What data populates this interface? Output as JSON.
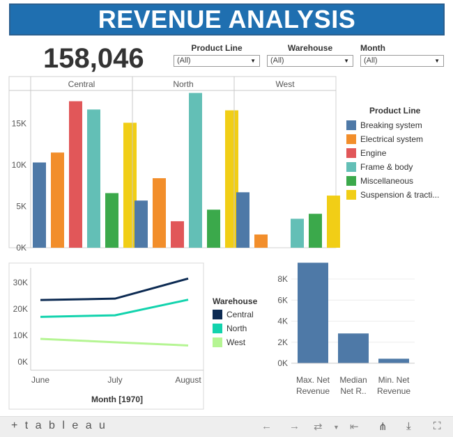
{
  "title": "REVENUE ANALYSIS",
  "kpi": "158,046",
  "filters": [
    {
      "label": "Product Line",
      "value": "(All)"
    },
    {
      "label": "Warehouse",
      "value": "(All)"
    },
    {
      "label": "Month",
      "value": "(All)"
    }
  ],
  "legend_product": {
    "title": "Product Line",
    "items": [
      {
        "label": "Breaking system",
        "color": "#4e79a7"
      },
      {
        "label": "Electrical system",
        "color": "#f28e2b"
      },
      {
        "label": "Engine",
        "color": "#e15759"
      },
      {
        "label": "Frame & body",
        "color": "#63bfb6"
      },
      {
        "label": "Miscellaneous",
        "color": "#3ba94b"
      },
      {
        "label": "Suspension & tracti...",
        "color": "#f1ce16"
      }
    ]
  },
  "legend_warehouse": {
    "title": "Warehouse",
    "items": [
      {
        "label": "Central",
        "color": "#0c2a52"
      },
      {
        "label": "North",
        "color": "#12d3ad"
      },
      {
        "label": "West",
        "color": "#b5f593"
      }
    ]
  },
  "footer": {
    "logo": "+ t a b l e a u"
  },
  "chart_data": [
    {
      "type": "bar",
      "panels": [
        "Central",
        "North",
        "West"
      ],
      "yticks": [
        "0K",
        "5K",
        "10K",
        "15K"
      ],
      "ylim": [
        0,
        19000
      ],
      "series": [
        {
          "name": "Breaking system",
          "values": [
            10300,
            5700,
            6700
          ]
        },
        {
          "name": "Electrical system",
          "values": [
            11500,
            8400,
            1600
          ]
        },
        {
          "name": "Engine",
          "values": [
            17700,
            3200,
            null
          ]
        },
        {
          "name": "Frame & body",
          "values": [
            16700,
            18700,
            3500
          ]
        },
        {
          "name": "Miscellaneous",
          "values": [
            6600,
            4600,
            4100
          ]
        },
        {
          "name": "Suspension & tracti...",
          "values": [
            15100,
            16600,
            6300
          ]
        }
      ]
    },
    {
      "type": "line",
      "categories": [
        "June",
        "July",
        "August"
      ],
      "xlabel": "Month [1970]",
      "yticks": [
        "0K",
        "10K",
        "20K",
        "30K"
      ],
      "ylim": [
        0,
        33000
      ],
      "series": [
        {
          "name": "Central",
          "values": [
            23400,
            23900,
            31500
          ]
        },
        {
          "name": "North",
          "values": [
            17000,
            17600,
            23500
          ]
        },
        {
          "name": "West",
          "values": [
            8700,
            7400,
            6200
          ]
        }
      ]
    },
    {
      "type": "bar",
      "categories": [
        "Max. Net Revenue",
        "Median Net R..",
        "Min. Net Revenue"
      ],
      "category_lines": [
        [
          "Max. Net",
          "Revenue"
        ],
        [
          "Median",
          "Net R.."
        ],
        [
          "Min. Net",
          "Revenue"
        ]
      ],
      "yticks": [
        "0K",
        "2K",
        "4K",
        "6K",
        "8K"
      ],
      "values": [
        9550,
        2830,
        430
      ],
      "ylim": [
        0,
        9600
      ]
    }
  ]
}
